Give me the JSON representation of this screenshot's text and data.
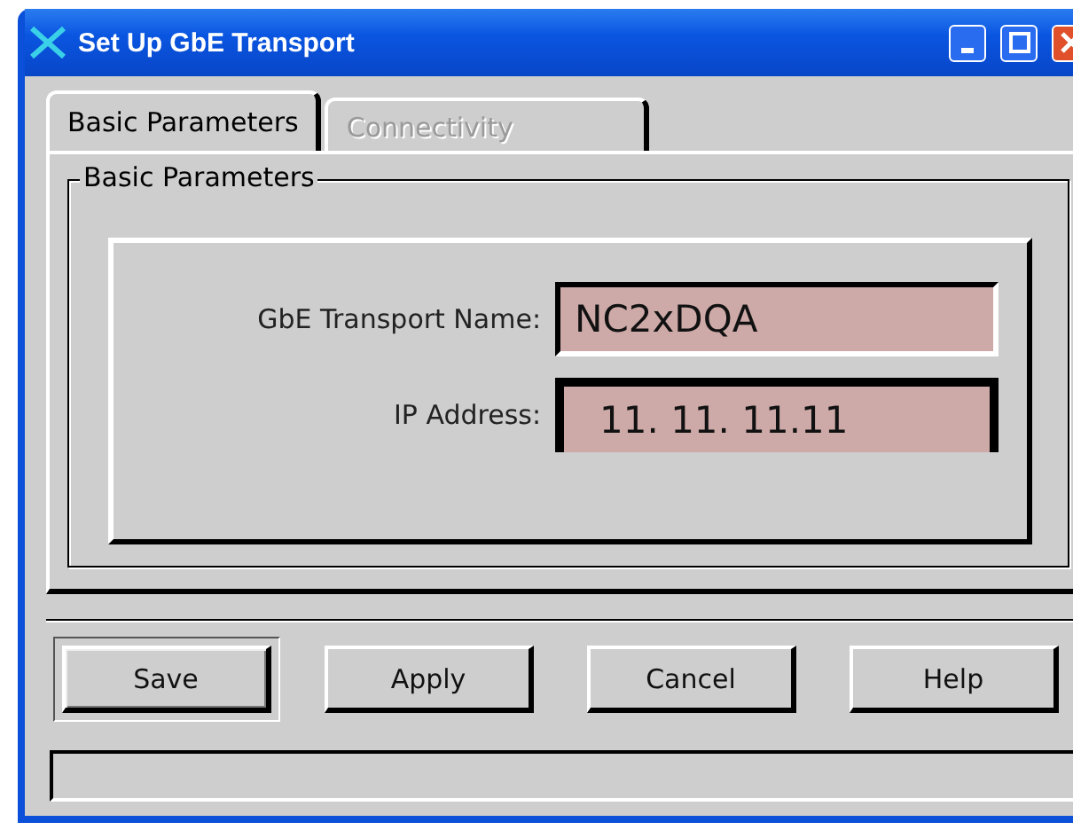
{
  "window": {
    "title": "Set Up GbE Transport"
  },
  "tabs": [
    {
      "label": "Basic Parameters",
      "selected": true,
      "disabled": false
    },
    {
      "label": "Connectivity",
      "selected": false,
      "disabled": true
    }
  ],
  "group": {
    "title": "Basic Parameters"
  },
  "fields": [
    {
      "label": "GbE Transport Name:",
      "value": "NC2xDQA",
      "focused": false
    },
    {
      "label": "IP Address:",
      "value": "11. 11. 11.11",
      "focused": true
    }
  ],
  "buttons": [
    {
      "label": "Save",
      "default": true
    },
    {
      "label": "Apply",
      "default": false
    },
    {
      "label": "Cancel",
      "default": false
    },
    {
      "label": "Help",
      "default": false
    }
  ]
}
